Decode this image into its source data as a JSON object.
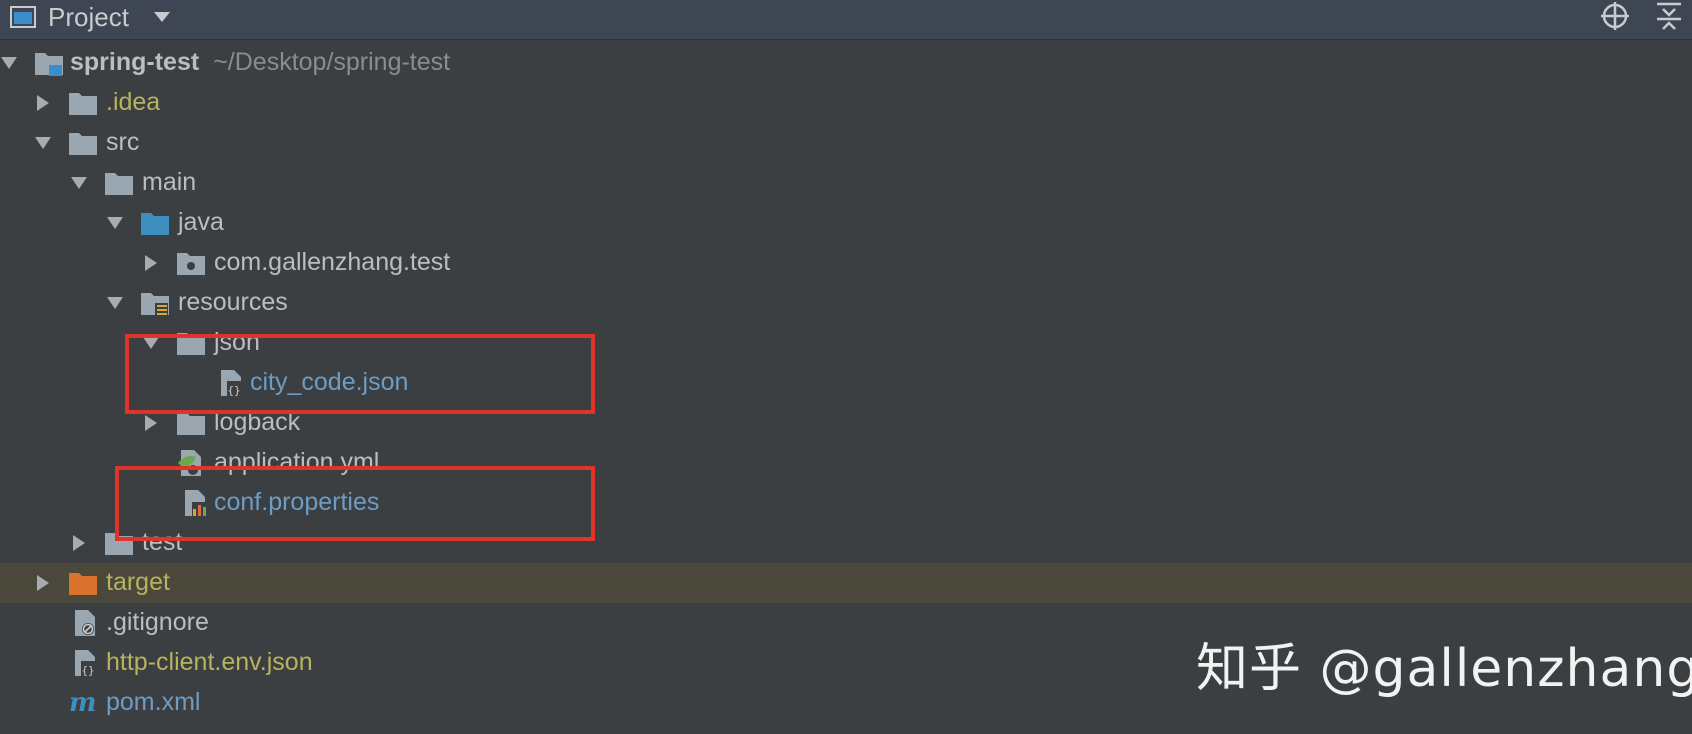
{
  "header": {
    "title": "Project",
    "icons": {
      "panel": "project-panel-icon",
      "dropdown": "chevron-down-icon",
      "locate": "locate-target-icon",
      "collapse": "collapse-all-icon"
    }
  },
  "tree": [
    {
      "label": "spring-test",
      "path": "~/Desktop/spring-test",
      "icon": "module-folder-icon",
      "arrow": "expanded",
      "depth": 0
    },
    {
      "label": ".idea",
      "icon": "folder-icon",
      "arrow": "collapsed",
      "depth": 1
    },
    {
      "label": "src",
      "icon": "folder-icon",
      "arrow": "expanded",
      "depth": 1
    },
    {
      "label": "main",
      "icon": "folder-icon",
      "arrow": "expanded",
      "depth": 2
    },
    {
      "label": "java",
      "icon": "source-folder-icon",
      "arrow": "expanded",
      "depth": 3
    },
    {
      "label": "com.gallenzhang.test",
      "icon": "package-icon",
      "arrow": "collapsed",
      "depth": 4
    },
    {
      "label": "resources",
      "icon": "resources-folder-icon",
      "arrow": "expanded",
      "depth": 3
    },
    {
      "label": "json",
      "icon": "folder-icon",
      "arrow": "expanded",
      "depth": 4
    },
    {
      "label": "city_code.json",
      "icon": "json-file-icon",
      "depth": 5
    },
    {
      "label": "logback",
      "icon": "folder-icon",
      "arrow": "collapsed",
      "depth": 4
    },
    {
      "label": "application.yml",
      "icon": "spring-yml-file-icon",
      "depth": 4
    },
    {
      "label": "conf.properties",
      "icon": "properties-file-icon",
      "depth": 4
    },
    {
      "label": "test",
      "icon": "folder-icon",
      "arrow": "collapsed",
      "depth": 2
    },
    {
      "label": "target",
      "icon": "excluded-folder-icon",
      "arrow": "collapsed",
      "depth": 1
    },
    {
      "label": ".gitignore",
      "icon": "ignore-file-icon",
      "depth": 1
    },
    {
      "label": "http-client.env.json",
      "icon": "json-file-icon",
      "depth": 1
    },
    {
      "label": "pom.xml",
      "icon": "maven-file-icon",
      "depth": 1
    }
  ],
  "colors": {
    "background": "#3c3f41",
    "header": "#3d4652",
    "text": "#bbbdbf",
    "highlight_row": "#4a473b",
    "ignored_text": "#b8b25e",
    "modified_text": "#6d9cc4",
    "annotation_red": "#e0342b"
  },
  "watermark": {
    "text": "知乎 @gallenzhang"
  }
}
